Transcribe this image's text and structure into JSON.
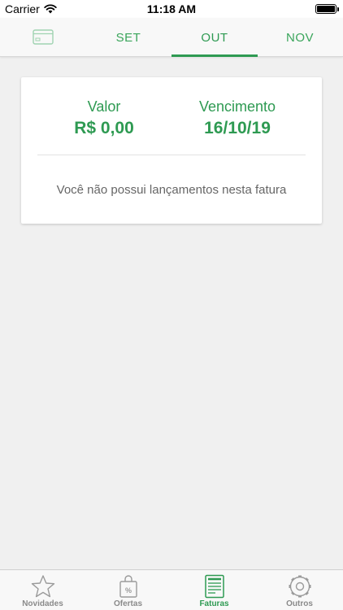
{
  "status_bar": {
    "carrier": "Carrier",
    "time": "11:18 AM",
    "icons": [
      "wifi-icon",
      "battery-icon"
    ]
  },
  "month_tabs": {
    "card_icon": "credit-card-icon",
    "items": [
      {
        "label": "SET",
        "active": false
      },
      {
        "label": "OUT",
        "active": true
      },
      {
        "label": "NOV",
        "active": false
      }
    ]
  },
  "invoice": {
    "valor_label": "Valor",
    "valor_value": "R$ 0,00",
    "vencimento_label": "Vencimento",
    "vencimento_value": "16/10/19",
    "empty_message": "Você não possui lançamentos nesta fatura"
  },
  "tab_bar": {
    "items": [
      {
        "label": "Novidades",
        "icon": "star-icon",
        "active": false
      },
      {
        "label": "Ofertas",
        "icon": "shopping-bag-icon",
        "active": false
      },
      {
        "label": "Faturas",
        "icon": "invoice-icon",
        "active": true
      },
      {
        "label": "Outros",
        "icon": "gear-icon",
        "active": false
      }
    ]
  },
  "colors": {
    "accent": "#2e9a52",
    "background": "#f0f0f0",
    "inactive": "#8a8a8a"
  }
}
